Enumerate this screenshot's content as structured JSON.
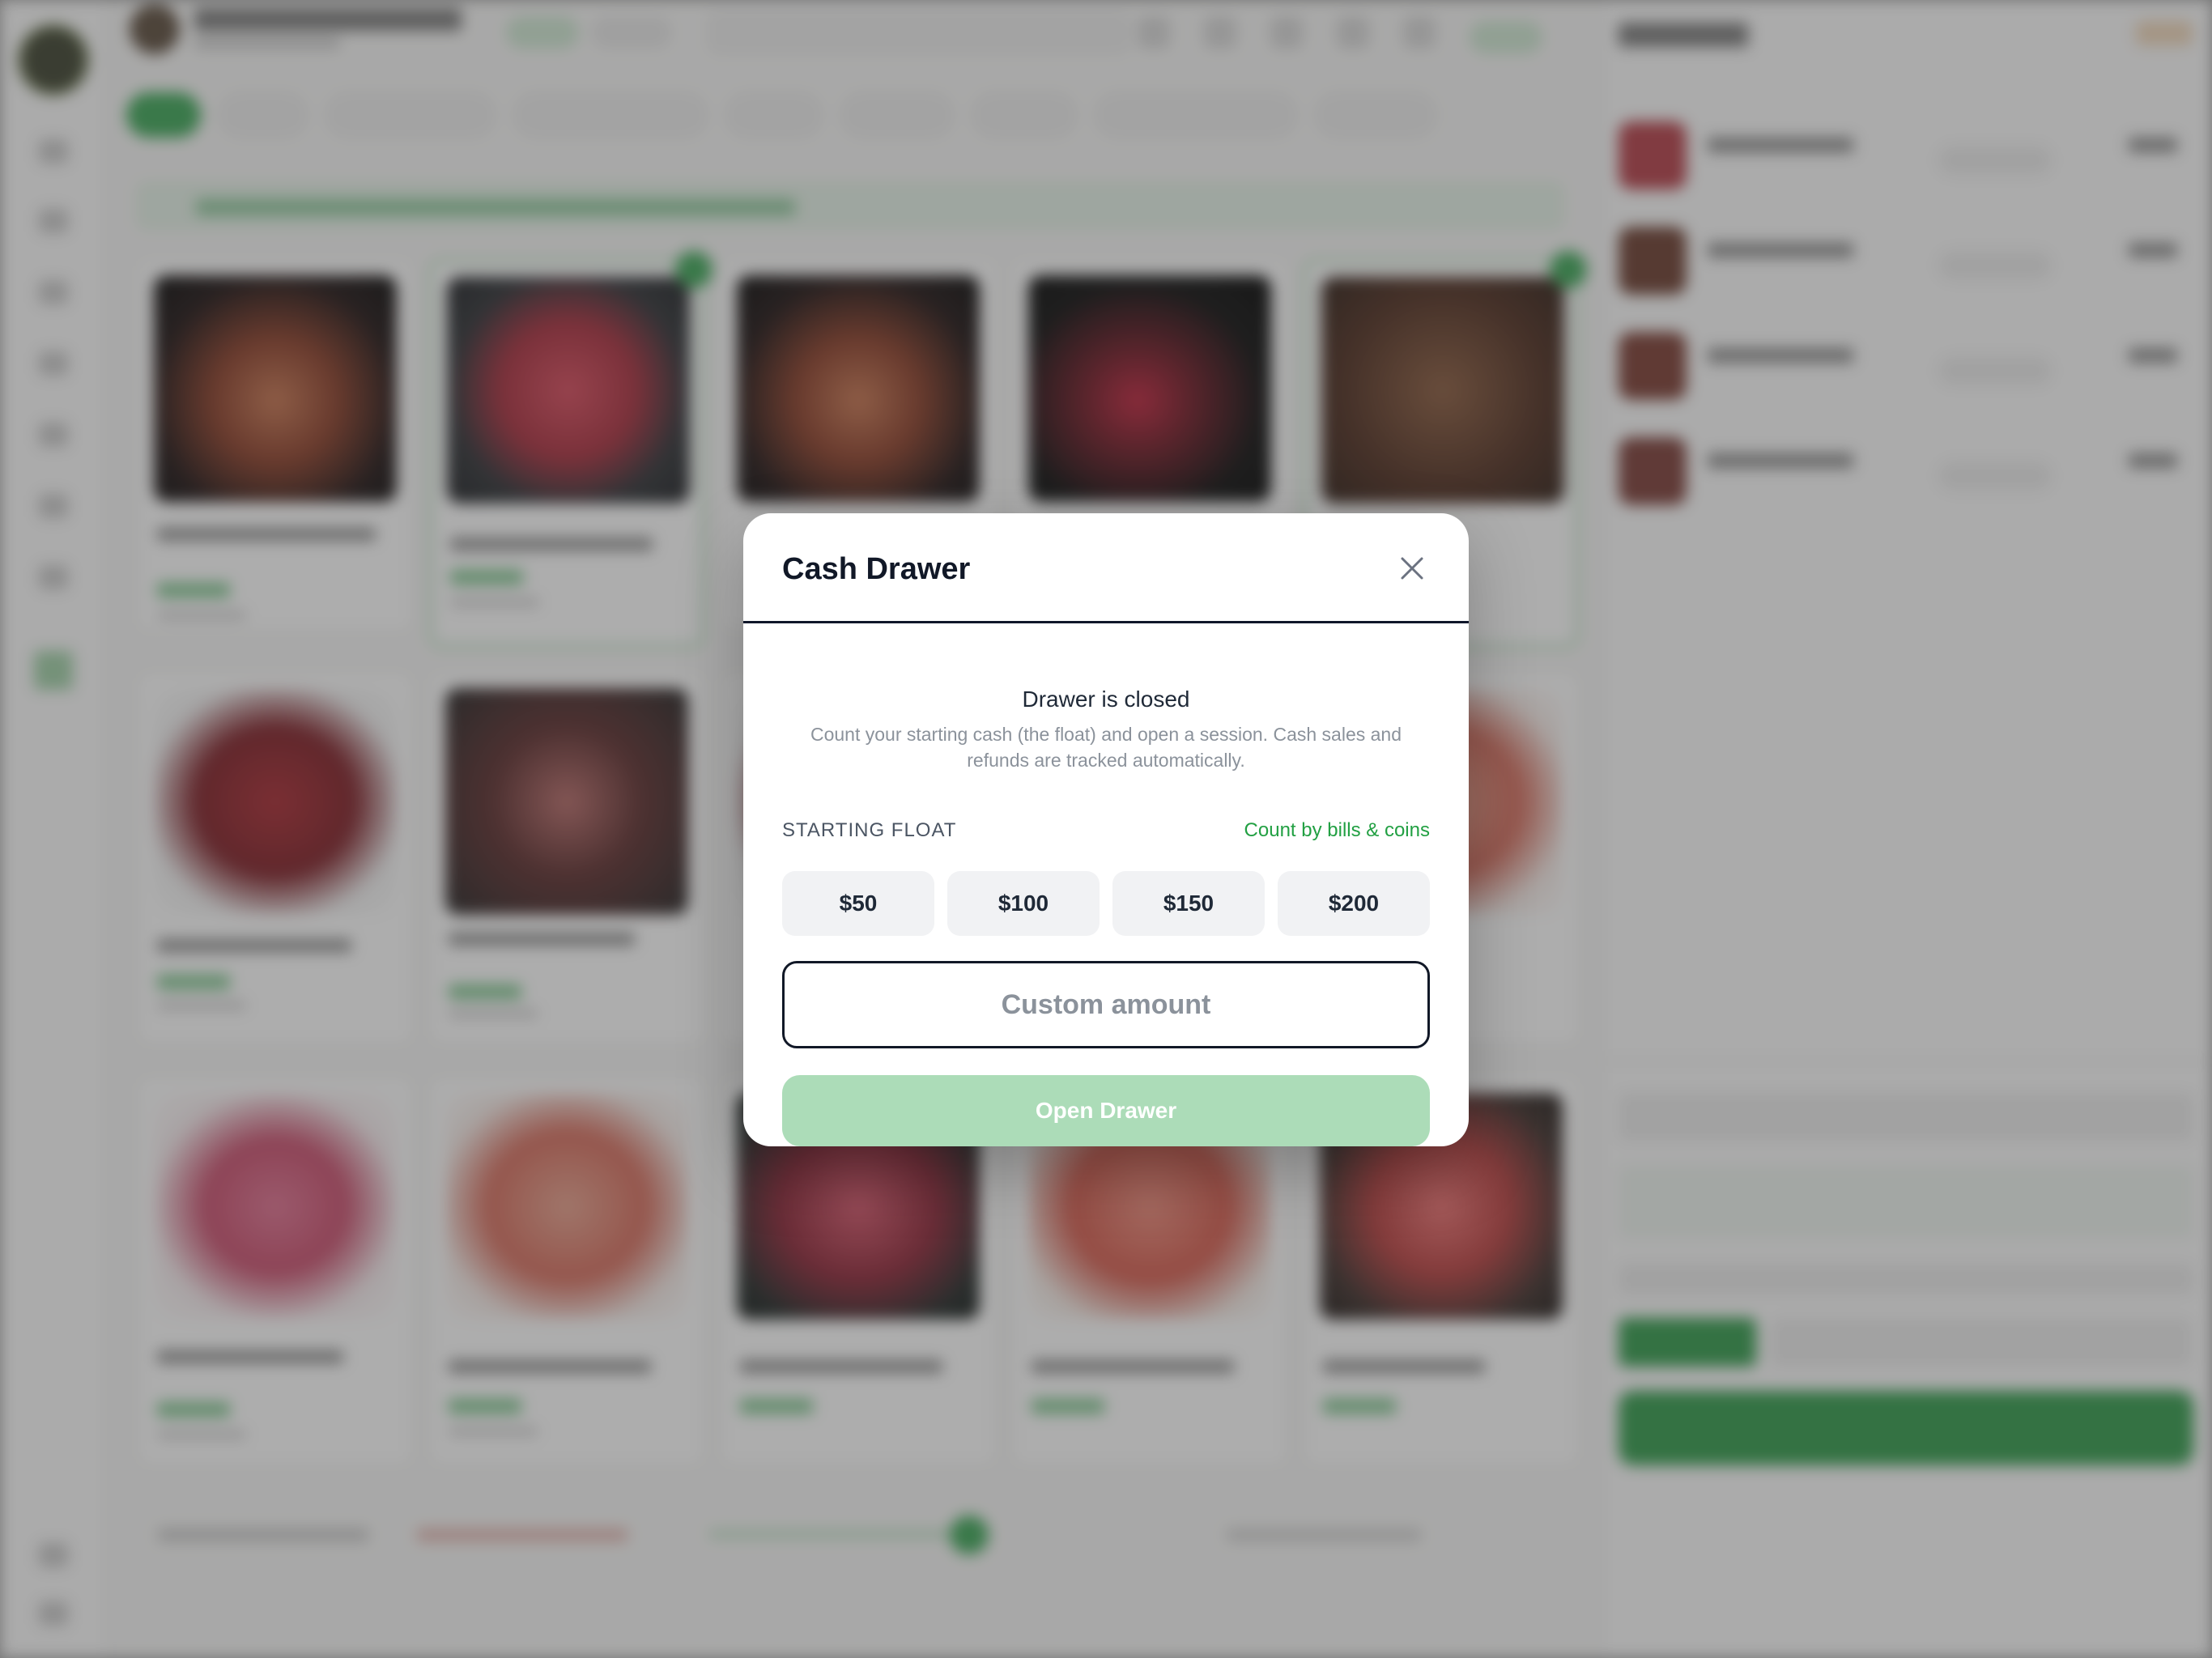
{
  "modal": {
    "title": "Cash Drawer",
    "close_icon": "close-icon",
    "status_title": "Drawer is closed",
    "description": "Count your starting cash (the float) and open a session. Cash sales and refunds are tracked automatically.",
    "float_label": "STARTING FLOAT",
    "count_link": "Count by bills & coins",
    "presets": [
      "$50",
      "$100",
      "$150",
      "$200"
    ],
    "custom_placeholder": "Custom amount",
    "custom_value": "",
    "open_button": "Open Drawer",
    "open_button_disabled": true
  },
  "colors": {
    "accent_green": "#22a043",
    "disabled_green": "#acdcb8",
    "text_dark": "#111827",
    "text_muted": "#8b929b"
  }
}
